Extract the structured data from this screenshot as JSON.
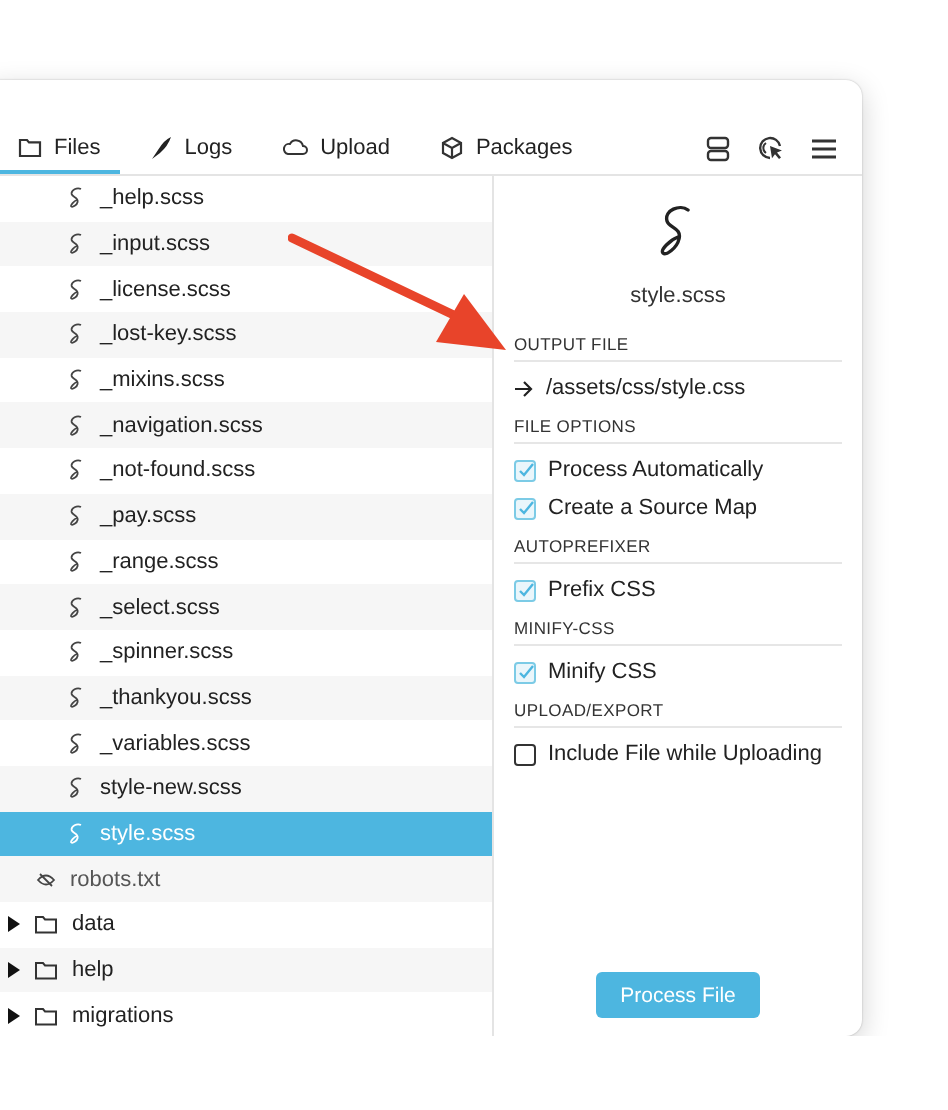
{
  "tabs": [
    {
      "label": "Files",
      "kind": "folder",
      "selected": true
    },
    {
      "label": "Logs",
      "kind": "feather",
      "selected": false
    },
    {
      "label": "Upload",
      "kind": "cloud",
      "selected": false
    },
    {
      "label": "Packages",
      "kind": "cube",
      "selected": false
    }
  ],
  "tree": [
    {
      "kind": "scss",
      "label": "_help.scss",
      "selected": false
    },
    {
      "kind": "scss",
      "label": "_input.scss",
      "selected": false
    },
    {
      "kind": "scss",
      "label": "_license.scss",
      "selected": false
    },
    {
      "kind": "scss",
      "label": "_lost-key.scss",
      "selected": false
    },
    {
      "kind": "scss",
      "label": "_mixins.scss",
      "selected": false
    },
    {
      "kind": "scss",
      "label": "_navigation.scss",
      "selected": false
    },
    {
      "kind": "scss",
      "label": "_not-found.scss",
      "selected": false
    },
    {
      "kind": "scss",
      "label": "_pay.scss",
      "selected": false
    },
    {
      "kind": "scss",
      "label": "_range.scss",
      "selected": false
    },
    {
      "kind": "scss",
      "label": "_select.scss",
      "selected": false
    },
    {
      "kind": "scss",
      "label": "_spinner.scss",
      "selected": false
    },
    {
      "kind": "scss",
      "label": "_thankyou.scss",
      "selected": false
    },
    {
      "kind": "scss",
      "label": "_variables.scss",
      "selected": false
    },
    {
      "kind": "scss",
      "label": "style-new.scss",
      "selected": false
    },
    {
      "kind": "scss",
      "label": "style.scss",
      "selected": true
    },
    {
      "kind": "hidden",
      "label": "robots.txt",
      "selected": false
    },
    {
      "kind": "folder",
      "label": "data",
      "selected": false,
      "expanded": false
    },
    {
      "kind": "folder",
      "label": "help",
      "selected": false,
      "expanded": false
    },
    {
      "kind": "folder",
      "label": "migrations",
      "selected": false,
      "expanded": false
    }
  ],
  "inspector": {
    "file_name": "style.scss",
    "sections": [
      {
        "heading": "OUTPUT FILE",
        "items": [
          {
            "kind": "path",
            "label": "/assets/css/style.css"
          }
        ]
      },
      {
        "heading": "FILE OPTIONS",
        "items": [
          {
            "kind": "checkbox",
            "label": "Process Automatically",
            "checked": true
          },
          {
            "kind": "checkbox",
            "label": "Create a Source Map",
            "checked": true
          }
        ]
      },
      {
        "heading": "AUTOPREFIXER",
        "items": [
          {
            "kind": "checkbox",
            "label": "Prefix CSS",
            "checked": true
          }
        ]
      },
      {
        "heading": "MINIFY-CSS",
        "items": [
          {
            "kind": "checkbox",
            "label": "Minify CSS",
            "checked": true
          }
        ]
      },
      {
        "heading": "UPLOAD/EXPORT",
        "items": [
          {
            "kind": "checkbox",
            "label": "Include File while Uploading",
            "checked": false
          }
        ]
      }
    ],
    "button": "Process File"
  }
}
